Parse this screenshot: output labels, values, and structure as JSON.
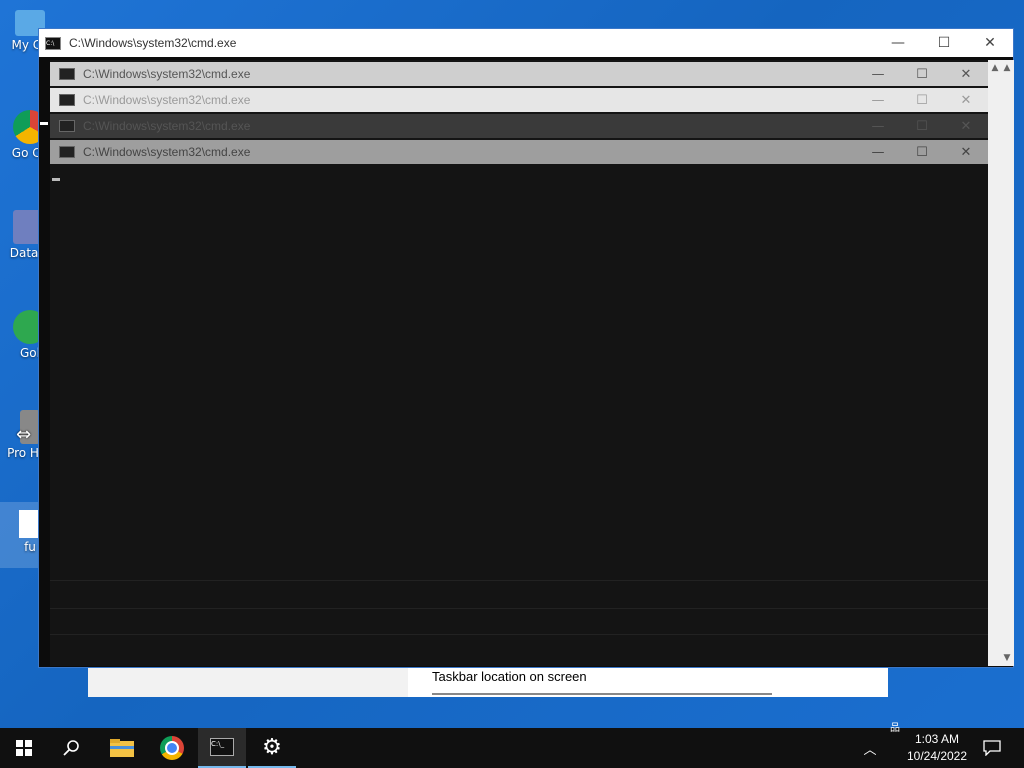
{
  "desktop": {
    "icons": [
      {
        "label": "My Co",
        "name": "desktop-icon-my-computer"
      },
      {
        "label": "Go Ch",
        "name": "desktop-icon-google-chrome"
      },
      {
        "label": "DataW",
        "name": "desktop-icon-datawrapper"
      },
      {
        "label": "Gol",
        "name": "desktop-icon-golang"
      },
      {
        "label": "Pro Hac",
        "name": "desktop-icon-process-hacker"
      },
      {
        "label": "fu",
        "name": "desktop-icon-file"
      }
    ]
  },
  "settings": {
    "taskbar_location_label": "Taskbar location on screen"
  },
  "cmd_window": {
    "title": "C:\\Windows\\system32\\cmd.exe",
    "minimize": "—",
    "maximize": "☐",
    "close": "✕",
    "ghost_titles": [
      "C:\\Windows\\system32\\cmd.exe",
      "C:\\Windows\\system32\\cmd.exe",
      "C:\\Windows\\system32\\cmd.exe",
      "C:\\Windows\\system32\\cmd.exe"
    ]
  },
  "taskbar": {
    "time": "1:03 AM",
    "date": "10/24/2022",
    "icons": [
      "start-icon",
      "search-icon",
      "file-explorer-icon",
      "chrome-icon",
      "cmd-icon",
      "settings-gear-icon",
      "chevron-up-icon",
      "network-icon",
      "notification-icon"
    ]
  }
}
